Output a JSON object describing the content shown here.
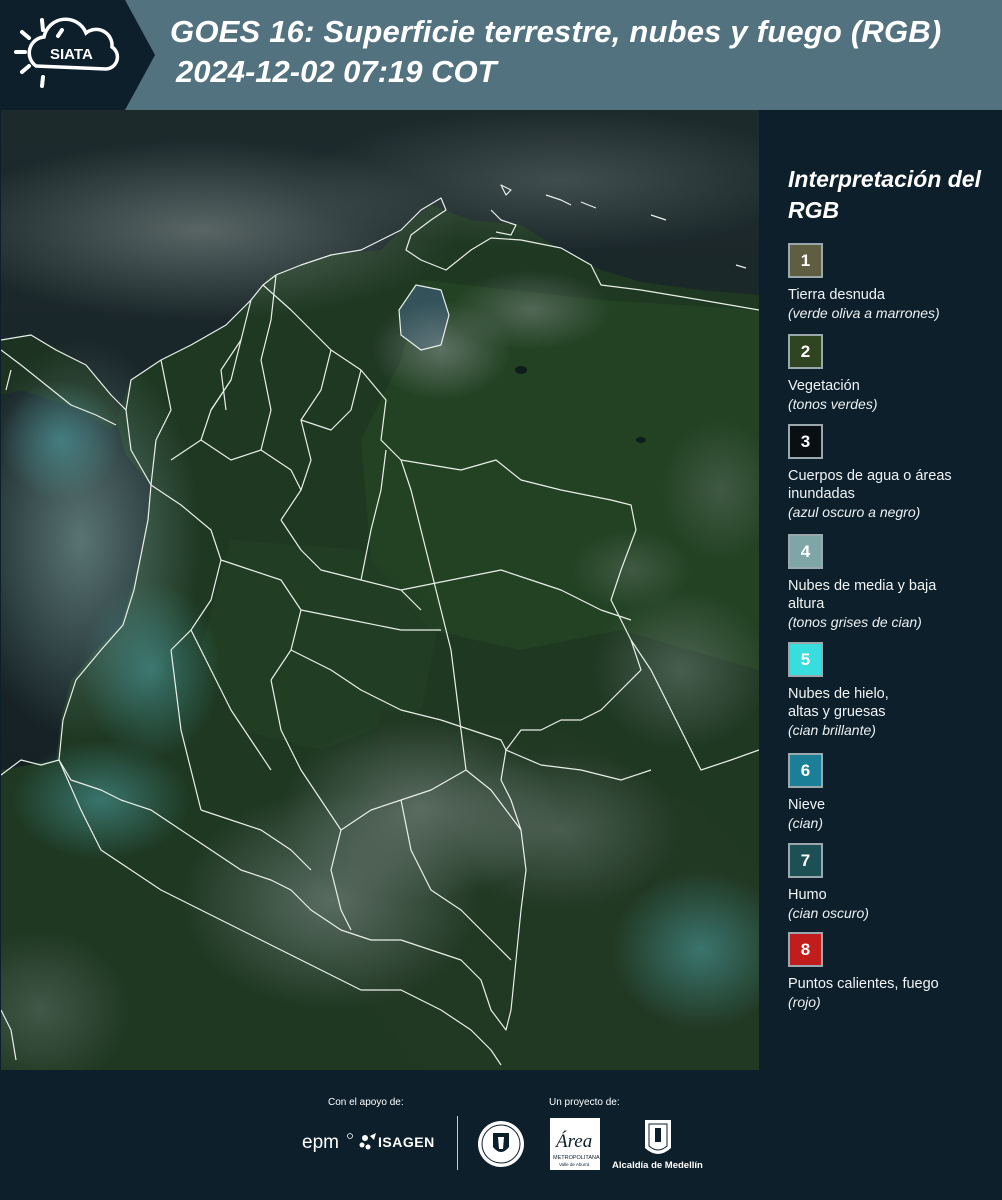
{
  "header": {
    "logo_text": "SIATA",
    "title_line1": "GOES 16: Superficie terrestre, nubes y fuego (RGB)",
    "title_line2": "2024-12-02 07:19 COT"
  },
  "legend": {
    "title": "Interpretación del RGB",
    "items": [
      {
        "number": "1",
        "label": "Tierra desnuda",
        "description": "(verde oliva a marrones)",
        "color": "#5f5e41"
      },
      {
        "number": "2",
        "label": "Vegetación",
        "description": "(tonos verdes)",
        "color": "#2f4521"
      },
      {
        "number": "3",
        "label": "Cuerpos de agua o áreas inundadas",
        "description": "(azul oscuro a negro)",
        "color": "#0a0f14"
      },
      {
        "number": "4",
        "label": "Nubes de media y baja altura",
        "description": "(tonos grises de cian)",
        "color": "#7fa6a6"
      },
      {
        "number": "5",
        "label": "Nubes de hielo, altas y gruesas",
        "description": "(cian brillante)",
        "color": "#37dedd"
      },
      {
        "number": "6",
        "label": "Nieve",
        "description": "(cian)",
        "color": "#1c7f98"
      },
      {
        "number": "7",
        "label": "Humo",
        "description": "(cian oscuro)",
        "color": "#1c5054"
      },
      {
        "number": "8",
        "label": "Puntos calientes, fuego",
        "description": "(rojo)",
        "color": "#c21d1d"
      }
    ]
  },
  "footer": {
    "support_label": "Con el apoyo de:",
    "project_label": "Un proyecto de:",
    "epm_logo_text": "epm",
    "isagen_logo_text": "ISAGEN",
    "area_logo_text": "Área",
    "area_logo_subtext": "METROPOLITANA",
    "area_logo_subtext2": "Valle de Aburrá",
    "alcaldia_logo_text": "Alcaldía de Medellín"
  },
  "colors": {
    "header_bg": "#51727e",
    "page_bg": "#0c1f2b",
    "map_land": "#1f3a22",
    "map_sea": "#0f1a1e",
    "boundary": "#e9efe9"
  }
}
